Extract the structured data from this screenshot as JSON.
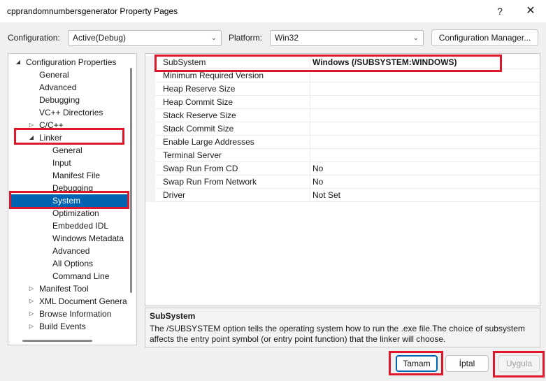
{
  "window": {
    "title": "cpprandomnumbersgenerator Property Pages",
    "help": "?",
    "close": "✕"
  },
  "toolbar": {
    "configuration_label": "Configuration:",
    "configuration_value": "Active(Debug)",
    "platform_label": "Platform:",
    "platform_value": "Win32",
    "config_manager": "Configuration Manager..."
  },
  "tree": {
    "items": [
      {
        "label": "Configuration Properties",
        "level": 0,
        "arrow": "◢"
      },
      {
        "label": "General",
        "level": 1,
        "arrow": ""
      },
      {
        "label": "Advanced",
        "level": 1,
        "arrow": ""
      },
      {
        "label": "Debugging",
        "level": 1,
        "arrow": ""
      },
      {
        "label": "VC++ Directories",
        "level": 1,
        "arrow": ""
      },
      {
        "label": "C/C++",
        "level": 1,
        "arrow": "▷"
      },
      {
        "label": "Linker",
        "level": 1,
        "arrow": "◢"
      },
      {
        "label": "General",
        "level": 2,
        "arrow": ""
      },
      {
        "label": "Input",
        "level": 2,
        "arrow": ""
      },
      {
        "label": "Manifest File",
        "level": 2,
        "arrow": ""
      },
      {
        "label": "Debugging",
        "level": 2,
        "arrow": ""
      },
      {
        "label": "System",
        "level": 2,
        "arrow": "",
        "selected": true
      },
      {
        "label": "Optimization",
        "level": 2,
        "arrow": ""
      },
      {
        "label": "Embedded IDL",
        "level": 2,
        "arrow": ""
      },
      {
        "label": "Windows Metadata",
        "level": 2,
        "arrow": ""
      },
      {
        "label": "Advanced",
        "level": 2,
        "arrow": ""
      },
      {
        "label": "All Options",
        "level": 2,
        "arrow": ""
      },
      {
        "label": "Command Line",
        "level": 2,
        "arrow": ""
      },
      {
        "label": "Manifest Tool",
        "level": 1,
        "arrow": "▷"
      },
      {
        "label": "XML Document Genera",
        "level": 1,
        "arrow": "▷"
      },
      {
        "label": "Browse Information",
        "level": 1,
        "arrow": "▷"
      },
      {
        "label": "Build Events",
        "level": 1,
        "arrow": "▷"
      }
    ]
  },
  "grid": {
    "rows": [
      {
        "name": "SubSystem",
        "value": "Windows (/SUBSYSTEM:WINDOWS)",
        "highlight": true
      },
      {
        "name": "Minimum Required Version",
        "value": ""
      },
      {
        "name": "Heap Reserve Size",
        "value": ""
      },
      {
        "name": "Heap Commit Size",
        "value": ""
      },
      {
        "name": "Stack Reserve Size",
        "value": ""
      },
      {
        "name": "Stack Commit Size",
        "value": ""
      },
      {
        "name": "Enable Large Addresses",
        "value": ""
      },
      {
        "name": "Terminal Server",
        "value": ""
      },
      {
        "name": "Swap Run From CD",
        "value": "No"
      },
      {
        "name": "Swap Run From Network",
        "value": "No"
      },
      {
        "name": "Driver",
        "value": "Not Set"
      }
    ]
  },
  "description": {
    "title": "SubSystem",
    "text": "The /SUBSYSTEM option tells the operating system how to run the .exe file.The choice of subsystem affects the entry point symbol (or entry point function) that the linker will choose."
  },
  "buttons": {
    "ok": "Tamam",
    "cancel": "İptal",
    "apply": "Uygula"
  },
  "icons": {
    "combo_chevron": "chevron-down-icon",
    "expanded": "expanded-triangle-icon",
    "collapsed": "collapsed-triangle-icon"
  },
  "colors": {
    "accent": "#0063b1",
    "annotation": "#e0162b"
  }
}
